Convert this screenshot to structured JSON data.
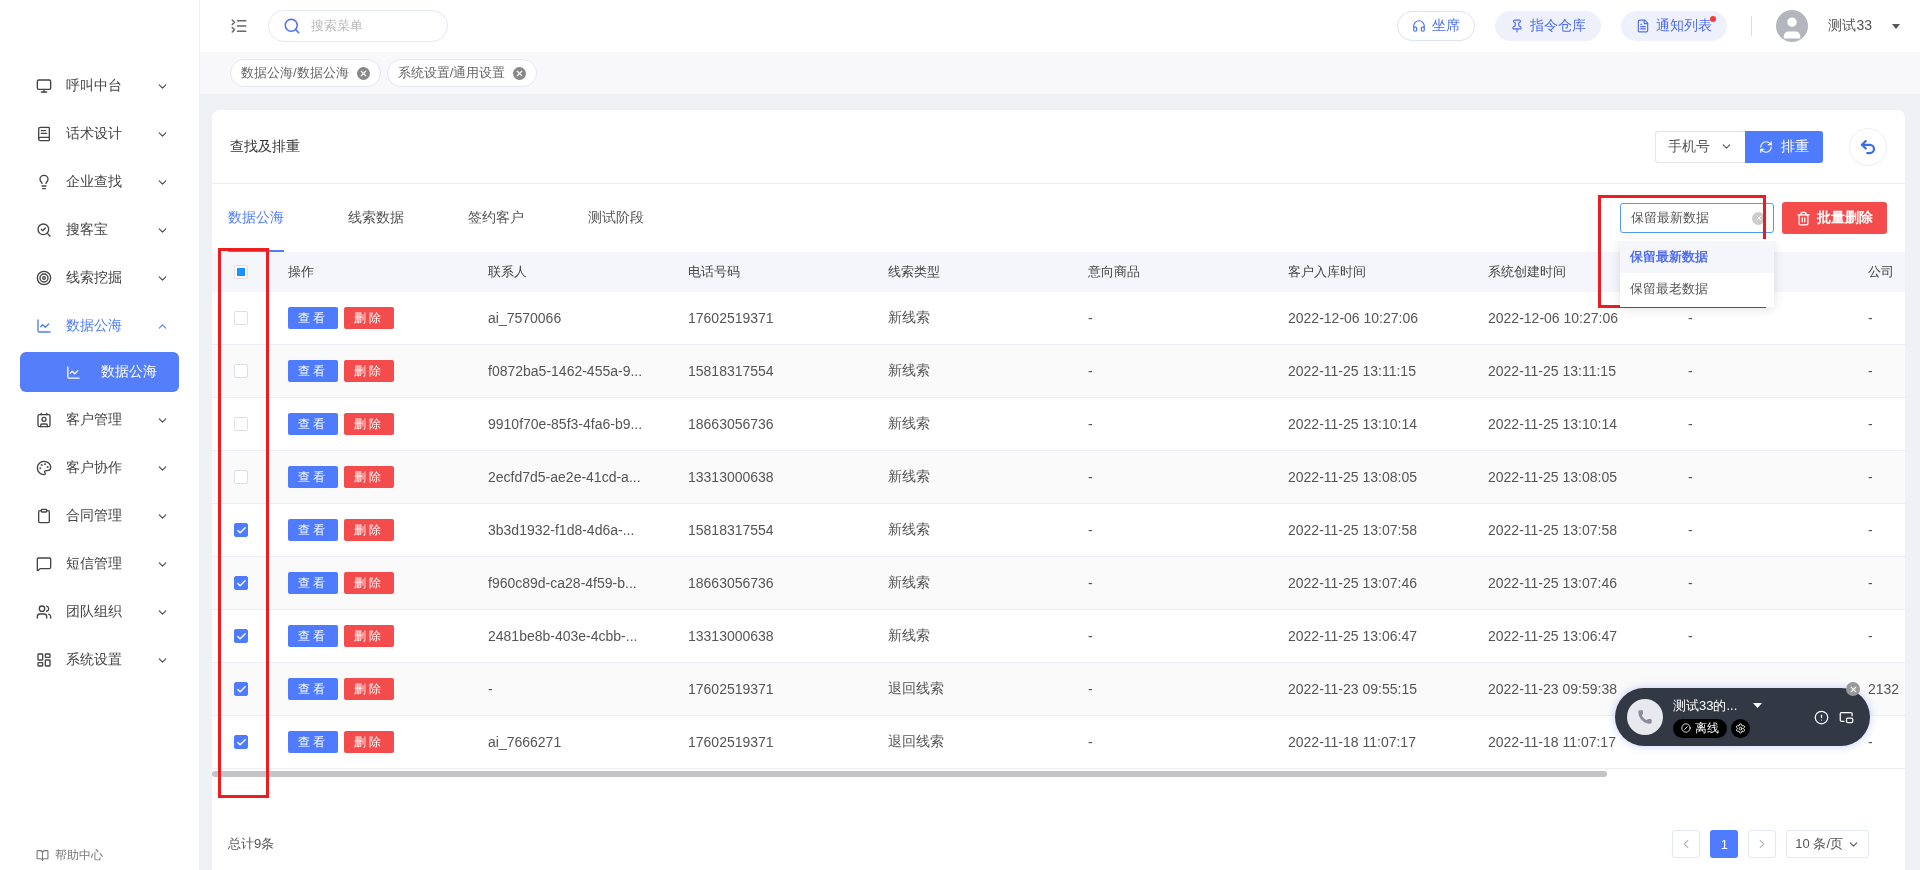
{
  "topbar": {
    "search_placeholder": "搜索菜单",
    "buttons": [
      {
        "label": "坐席",
        "kind": "outline",
        "badge": false
      },
      {
        "label": "指令仓库",
        "kind": "soft",
        "badge": false
      },
      {
        "label": "通知列表",
        "kind": "soft",
        "badge": true
      }
    ],
    "user": "测试33"
  },
  "open_tabs": [
    {
      "label": "数据公海/数据公海"
    },
    {
      "label": "系统设置/通用设置"
    }
  ],
  "sidebar": {
    "items": [
      {
        "label": "呼叫中台",
        "expanded": false
      },
      {
        "label": "话术设计",
        "expanded": false
      },
      {
        "label": "企业查找",
        "expanded": false
      },
      {
        "label": "搜客宝",
        "expanded": false
      },
      {
        "label": "线索挖掘",
        "expanded": false
      },
      {
        "label": "数据公海",
        "expanded": true,
        "children": [
          {
            "label": "数据公海",
            "selected": true
          }
        ]
      },
      {
        "label": "客户管理",
        "expanded": false
      },
      {
        "label": "客户协作",
        "expanded": false
      },
      {
        "label": "合同管理",
        "expanded": false
      },
      {
        "label": "短信管理",
        "expanded": false
      },
      {
        "label": "团队组织",
        "expanded": false
      },
      {
        "label": "系统设置",
        "expanded": false
      }
    ],
    "help": "帮助中心"
  },
  "card": {
    "title": "查找及排重",
    "field_select": "手机号",
    "dedupe_button": "排重"
  },
  "tabs": [
    {
      "label": "数据公海",
      "selected": true
    },
    {
      "label": "线索数据",
      "selected": false
    },
    {
      "label": "签约客户",
      "selected": false
    },
    {
      "label": "测试阶段",
      "selected": false
    }
  ],
  "keep_select": {
    "value": "保留最新数据",
    "expanded": true,
    "options": [
      {
        "label": "保留最新数据",
        "selected": true
      },
      {
        "label": "保留最老数据",
        "selected": false
      }
    ]
  },
  "batch_delete": "批量删除",
  "table": {
    "select_all": {
      "checked": false,
      "indeterminate": true
    },
    "action_column": "操作",
    "columns": [
      "联系人",
      "电话号码",
      "线索类型",
      "意向商品",
      "客户入库时间",
      "系统创建时间",
      "",
      "公司"
    ],
    "rows": [
      {
        "checked": false,
        "actions": [
          "查看",
          "删除"
        ],
        "cells": [
          "ai_7570066",
          "17602519371",
          "新线索",
          "-",
          "2022-12-06 10:27:06",
          "2022-12-06 10:27:06",
          "-",
          "-"
        ]
      },
      {
        "checked": false,
        "actions": [
          "查看",
          "删除"
        ],
        "cells": [
          "f0872ba5-1462-455a-9...",
          "15818317554",
          "新线索",
          "-",
          "2022-11-25 13:11:15",
          "2022-11-25 13:11:15",
          "-",
          "-"
        ]
      },
      {
        "checked": false,
        "actions": [
          "查看",
          "删除"
        ],
        "cells": [
          "9910f70e-85f3-4fa6-b9...",
          "18663056736",
          "新线索",
          "-",
          "2022-11-25 13:10:14",
          "2022-11-25 13:10:14",
          "-",
          "-"
        ]
      },
      {
        "checked": false,
        "actions": [
          "查看",
          "删除"
        ],
        "cells": [
          "2ecfd7d5-ae2e-41cd-a...",
          "13313000638",
          "新线索",
          "-",
          "2022-11-25 13:08:05",
          "2022-11-25 13:08:05",
          "-",
          "-"
        ]
      },
      {
        "checked": true,
        "actions": [
          "查看",
          "删除"
        ],
        "cells": [
          "3b3d1932-f1d8-4d6a-...",
          "15818317554",
          "新线索",
          "-",
          "2022-11-25 13:07:58",
          "2022-11-25 13:07:58",
          "-",
          "-"
        ]
      },
      {
        "checked": true,
        "actions": [
          "查看",
          "删除"
        ],
        "cells": [
          "f960c89d-ca28-4f59-b...",
          "18663056736",
          "新线索",
          "-",
          "2022-11-25 13:07:46",
          "2022-11-25 13:07:46",
          "-",
          "-"
        ]
      },
      {
        "checked": true,
        "actions": [
          "查看",
          "删除"
        ],
        "cells": [
          "2481be8b-403e-4cbb-...",
          "13313000638",
          "新线索",
          "-",
          "2022-11-25 13:06:47",
          "2022-11-25 13:06:47",
          "-",
          "-"
        ]
      },
      {
        "checked": true,
        "actions": [
          "查看",
          "删除"
        ],
        "cells": [
          "-",
          "17602519371",
          "退回线索",
          "-",
          "2022-11-23 09:55:15",
          "2022-11-23 09:59:38",
          null,
          "2132"
        ]
      },
      {
        "checked": true,
        "actions": [
          "查看",
          "删除"
        ],
        "cells": [
          "ai_7666271",
          "17602519371",
          "退回线索",
          "-",
          "2022-11-18 11:07:17",
          "2022-11-18 11:07:17",
          null,
          "-"
        ]
      }
    ]
  },
  "footer": {
    "total": "总计9条",
    "pages": [
      {
        "label": "1",
        "selected": true
      }
    ],
    "page_size": "10 条/页"
  },
  "call_widget": {
    "name": "测试33的...",
    "status": "离线"
  }
}
